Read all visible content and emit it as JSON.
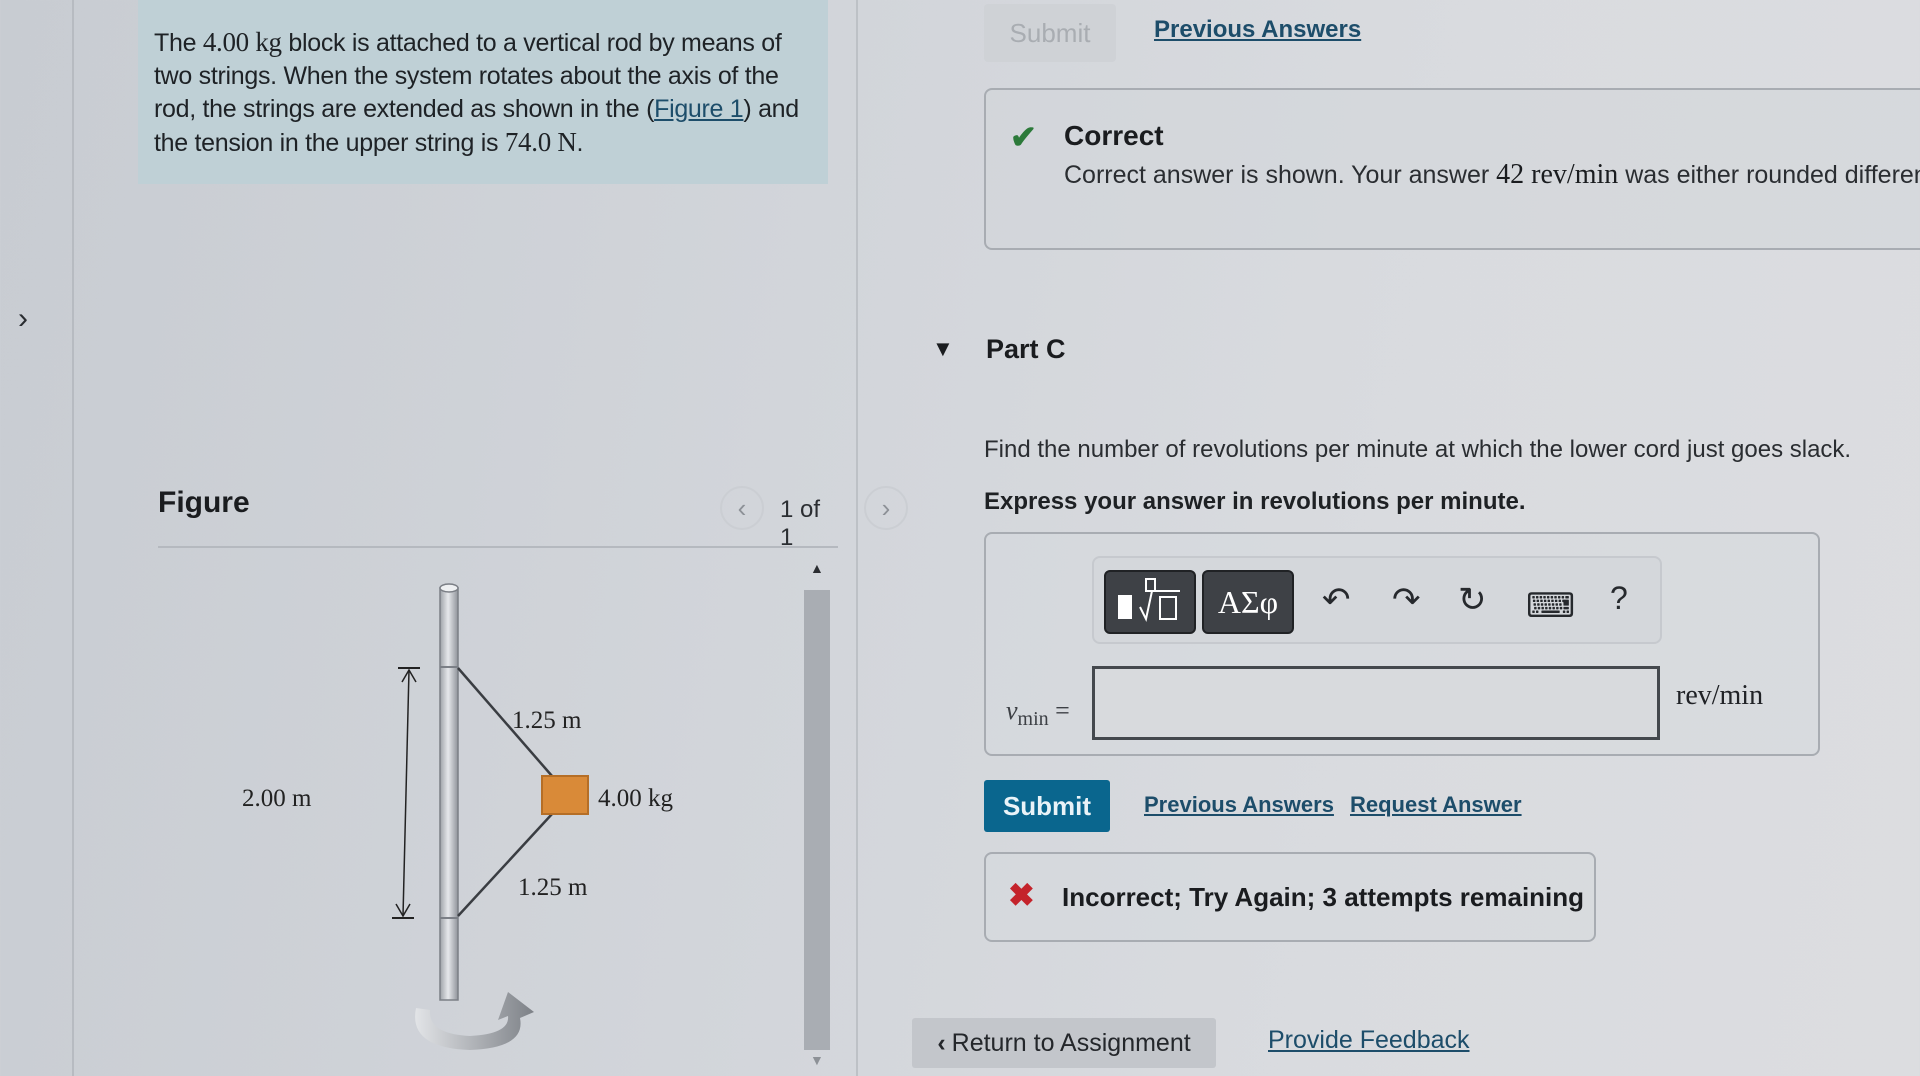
{
  "gutter": {
    "expand_icon": "chevron-right-icon",
    "glyph": "›"
  },
  "problem": {
    "text_before_mass": "The ",
    "mass": "4.00 kg",
    "text_after_mass": " block is attached to a vertical rod by means of two strings. When the system rotates about the axis of the rod, the strings are extended as shown in the ",
    "figure_link": "Figure 1",
    "text_after_link": ") and the tension in the upper string is ",
    "tension": "74.0 N",
    "text_end": "."
  },
  "figure": {
    "title": "Figure",
    "pager": "1 of 1",
    "prev_glyph": "‹",
    "next_glyph": "›",
    "labels": {
      "height": "2.00 m",
      "upper_string": "1.25 m",
      "lower_string": "1.25 m",
      "mass": "4.00 kg"
    },
    "block_color": "#d98a38"
  },
  "scrollbar": {
    "up_glyph": "▲",
    "down_glyph": "▼"
  },
  "previous_part": {
    "submit_label": "Submit",
    "previous_answers_label": "Previous Answers",
    "feedback": {
      "status": "Correct",
      "icon": "check-icon",
      "message_before": "Correct answer is shown. Your answer ",
      "answer": "42 rev/min",
      "message_after": " was either rounded differently or used a different number of significant figures than required for this part."
    }
  },
  "part_c": {
    "title": "Part C",
    "question": "Find the number of revolutions per minute at which the lower cord just goes slack.",
    "instruction": "Express your answer in revolutions per minute.",
    "toolbar": {
      "templates_label": "templates",
      "greek_label": "ΑΣφ",
      "undo_glyph": "↶",
      "redo_glyph": "↷",
      "reset_glyph": "↻",
      "keyboard_glyph": "⌨",
      "help_glyph": "?"
    },
    "variable": "ν",
    "variable_sub": "min",
    "equals": "=",
    "input_value": "",
    "units": "rev/min",
    "submit_label": "Submit",
    "previous_answers_label": "Previous Answers",
    "request_answer_label": "Request Answer",
    "feedback": {
      "icon": "x-icon",
      "message": "Incorrect; Try Again; 3 attempts remaining"
    }
  },
  "footer": {
    "return_label": "Return to Assignment",
    "feedback_label": "Provide Feedback"
  },
  "colors": {
    "accent": "#0a668e",
    "link": "#1d4d6a",
    "correct": "#2c7a3a",
    "incorrect": "#c4232b",
    "problem_bg": "#bfd0d6"
  }
}
